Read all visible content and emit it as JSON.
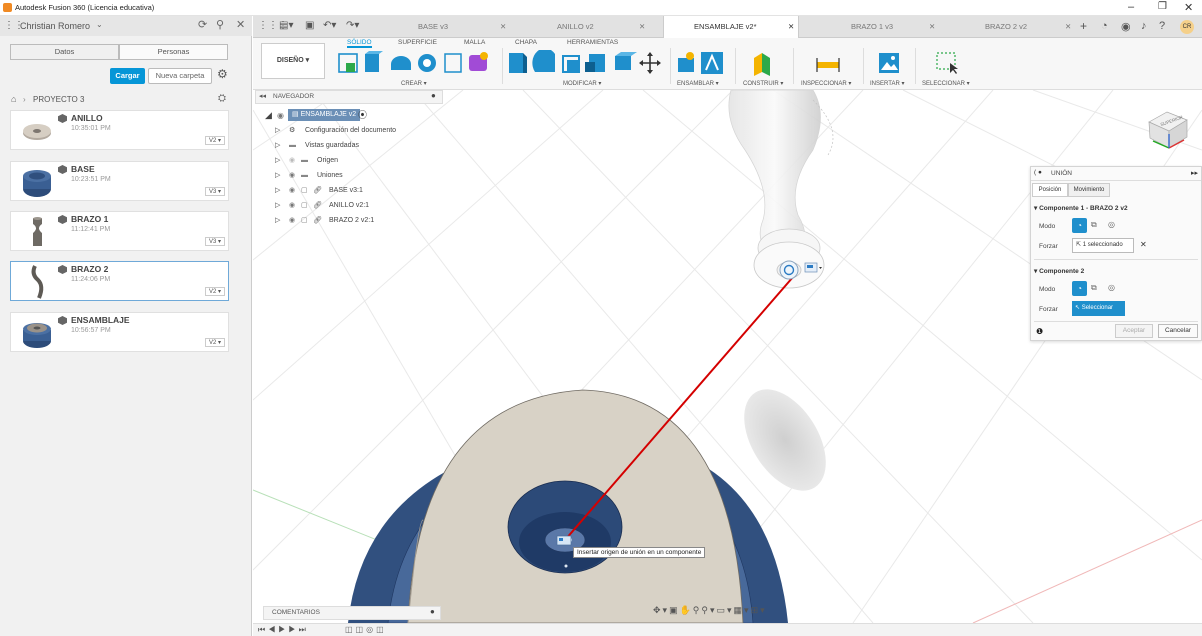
{
  "window": {
    "title": "Autodesk Fusion 360 (Licencia educativa)"
  },
  "user": {
    "name": "Christian Romero"
  },
  "data_panel": {
    "tabs": [
      "Datos",
      "Personas"
    ],
    "upload_label": "Cargar",
    "new_folder_label": "Nueva carpeta",
    "breadcrumb": "PROYECTO 3",
    "items": [
      {
        "name": "ANILLO",
        "time": "10:35:01 PM",
        "version": "V2"
      },
      {
        "name": "BASE",
        "time": "10:23:51 PM",
        "version": "V3"
      },
      {
        "name": "BRAZO 1",
        "time": "11:12:41 PM",
        "version": "V3"
      },
      {
        "name": "BRAZO 2",
        "time": "11:24:06 PM",
        "version": "V2"
      },
      {
        "name": "ENSAMBLAJE",
        "time": "10:56:57 PM",
        "version": "V2"
      }
    ]
  },
  "tabs": [
    {
      "label": "BASE v3"
    },
    {
      "label": "ANILLO v2"
    },
    {
      "label": "ENSAMBLAJE v2*"
    },
    {
      "label": "BRAZO 1 v3"
    },
    {
      "label": "BRAZO 2 v2"
    }
  ],
  "toolbar": {
    "workspace": "DISEÑO",
    "subtabs": [
      "SÓLIDO",
      "SUPERFICIE",
      "MALLA",
      "CHAPA",
      "HERRAMIENTAS"
    ],
    "groups": [
      "CREAR",
      "MODIFICAR",
      "ENSAMBLAR",
      "CONSTRUIR",
      "INSPECCIONAR",
      "INSERTAR",
      "SELECCIONAR"
    ]
  },
  "navigator": {
    "title": "NAVEGADOR",
    "root": "ENSAMBLAJE v2",
    "rows": [
      "Configuración del documento",
      "Vistas guardadas",
      "Origen",
      "Uniones",
      "BASE v3:1",
      "ANILLO v2:1",
      "BRAZO 2 v2:1"
    ]
  },
  "comments": {
    "label": "COMENTARIOS"
  },
  "joint_panel": {
    "title": "UNIÓN",
    "tabs": [
      "Posición",
      "Movimiento"
    ],
    "component1": "Componente 1 - BRAZO 2 v2",
    "component2": "Componente 2",
    "mode_label": "Modo",
    "snap_label": "Forzar",
    "snap1_value": "1 seleccionado",
    "snap2_value": "Seleccionar",
    "ok_label": "Aceptar",
    "cancel_label": "Cancelar"
  },
  "viewcube": {
    "face": "SUPERIOR"
  },
  "tooltip": {
    "text": "Insertar origen de unión en un componente"
  },
  "colors": {
    "accent": "#0696d7",
    "red_line": "#d40000",
    "base_blue": "#3d5f8e",
    "ring_beige": "#d8d2c6"
  }
}
